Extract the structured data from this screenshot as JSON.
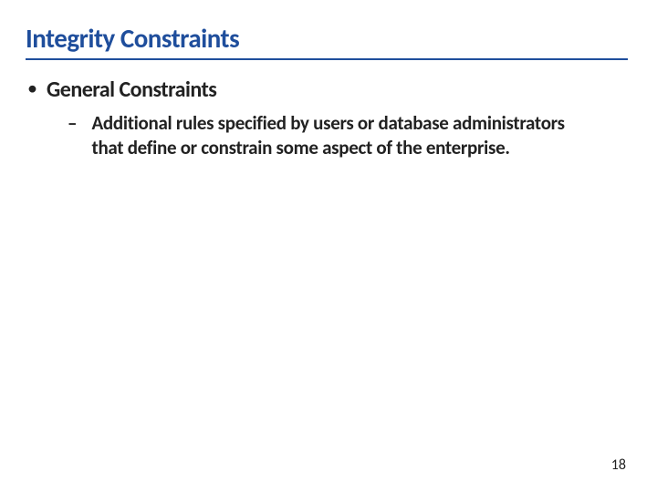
{
  "slide": {
    "title": "Integrity Constraints",
    "bullets": [
      {
        "level": 1,
        "text": "General Constraints"
      },
      {
        "level": 2,
        "text": "Additional rules specified by users or database administrators that define or constrain some aspect of the enterprise."
      }
    ],
    "page_number": "18"
  }
}
